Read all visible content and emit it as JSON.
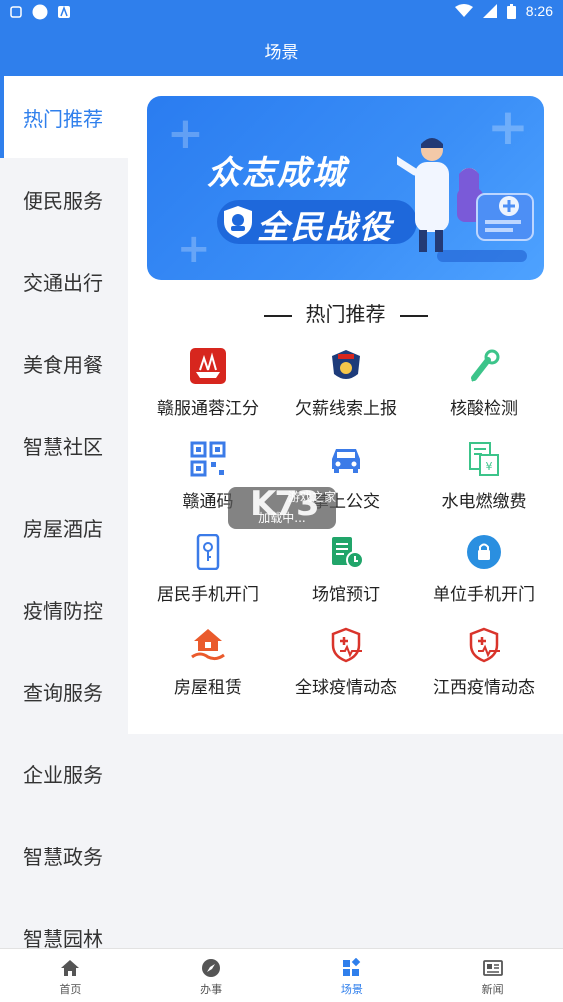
{
  "status_bar": {
    "time": "8:26"
  },
  "header": {
    "title": "场景"
  },
  "sidebar": {
    "items": [
      {
        "label": "热门推荐",
        "active": true
      },
      {
        "label": "便民服务"
      },
      {
        "label": "交通出行"
      },
      {
        "label": "美食用餐"
      },
      {
        "label": "智慧社区"
      },
      {
        "label": "房屋酒店"
      },
      {
        "label": "疫情防控"
      },
      {
        "label": "查询服务"
      },
      {
        "label": "企业服务"
      },
      {
        "label": "智慧政务"
      },
      {
        "label": "智慧园林"
      }
    ]
  },
  "banner": {
    "line1": "众志成城",
    "line2": "全民战役"
  },
  "section": {
    "title": "热门推荐"
  },
  "grid": {
    "items": [
      {
        "label": "赣服通蓉江分",
        "icon": "ship-icon",
        "color": "#d7261e"
      },
      {
        "label": "欠薪线索上报",
        "icon": "police-badge-icon",
        "color": "#1d3b7a"
      },
      {
        "label": "核酸检测",
        "icon": "dropper-icon",
        "color": "#3cc48a"
      },
      {
        "label": "赣通码",
        "icon": "qr-code-icon",
        "color": "#3b7be8"
      },
      {
        "label": "掌上公交",
        "icon": "bus-icon",
        "color": "#3b7be8"
      },
      {
        "label": "水电燃缴费",
        "icon": "bill-icon",
        "color": "#3cc48a"
      },
      {
        "label": "居民手机开门",
        "icon": "phone-key-icon",
        "color": "#3b7be8"
      },
      {
        "label": "场馆预订",
        "icon": "venue-icon",
        "color": "#21a56a"
      },
      {
        "label": "单位手机开门",
        "icon": "lock-icon",
        "color": "#2a8fe0"
      },
      {
        "label": "房屋租赁",
        "icon": "house-hand-icon",
        "color": "#ea5a2c"
      },
      {
        "label": "全球疫情动态",
        "icon": "shield-pulse-icon",
        "color": "#d9342b"
      },
      {
        "label": "江西疫情动态",
        "icon": "shield-pulse-icon",
        "color": "#d9342b"
      }
    ]
  },
  "toast": {
    "text": "加载中..."
  },
  "watermark": {
    "logo": "K73",
    "sub": "游戏之家"
  },
  "tabbar": {
    "items": [
      {
        "label": "首页",
        "icon": "home-icon"
      },
      {
        "label": "办事",
        "icon": "compass-icon"
      },
      {
        "label": "场景",
        "icon": "grid-icon",
        "active": true
      },
      {
        "label": "新闻",
        "icon": "news-icon"
      }
    ]
  },
  "colors": {
    "primary": "#2f7fec",
    "sidebar_bg": "#f3f4f7"
  }
}
